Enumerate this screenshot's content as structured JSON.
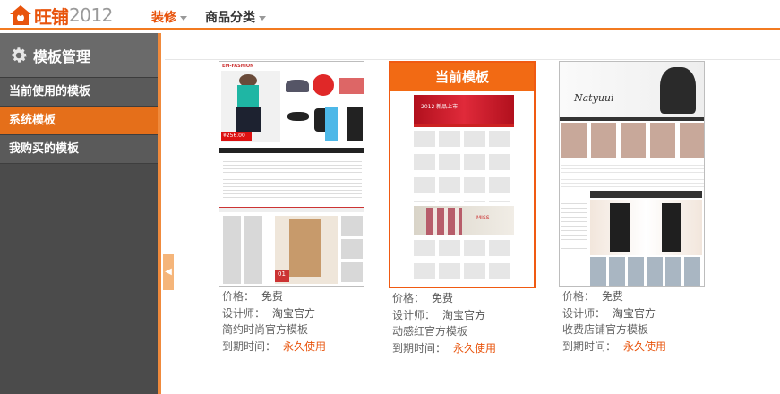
{
  "header": {
    "brand": "旺铺",
    "year": "2012",
    "nav": [
      {
        "label": "装修",
        "active": true
      },
      {
        "label": "商品分类",
        "active": false
      }
    ]
  },
  "sidebar": {
    "title": "模板管理",
    "items": [
      {
        "label": "当前使用的模板",
        "active": false
      },
      {
        "label": "系统模板",
        "active": true
      },
      {
        "label": "我购买的模板",
        "active": false
      }
    ]
  },
  "templates": [
    {
      "price_label": "价格：",
      "price": "免费",
      "designer_label": "设计师：",
      "designer": "淘宝官方",
      "name": "简约时尚官方模板",
      "expire_label": "到期时间：",
      "expire": "永久使用",
      "current": false,
      "thumb_text": [
        "EM-FASHION",
        "¥256.00",
        "01"
      ]
    },
    {
      "price_label": "价格：",
      "price": "免费",
      "designer_label": "设计师：",
      "designer": "淘宝官方",
      "name": "动感红官方模板",
      "expire_label": "到期时间：",
      "expire": "永久使用",
      "current": true,
      "banner": "当前模板",
      "thumb_text": [
        "2012 新品上市",
        "MISS"
      ]
    },
    {
      "price_label": "价格：",
      "price": "免费",
      "designer_label": "设计师：",
      "designer": "淘宝官方",
      "name": "收费店铺官方模板",
      "expire_label": "到期时间：",
      "expire": "永久使用",
      "current": false,
      "thumb_text": [
        "Natyuui"
      ]
    }
  ],
  "colors": {
    "accent": "#f26a14",
    "sidebar_bg": "#4b4b4b",
    "sidebar_active": "#e56f1a"
  },
  "icons": {
    "logo": "house-icon",
    "sidebar_head": "gear-icon",
    "collapse": "collapse-arrow-icon"
  }
}
